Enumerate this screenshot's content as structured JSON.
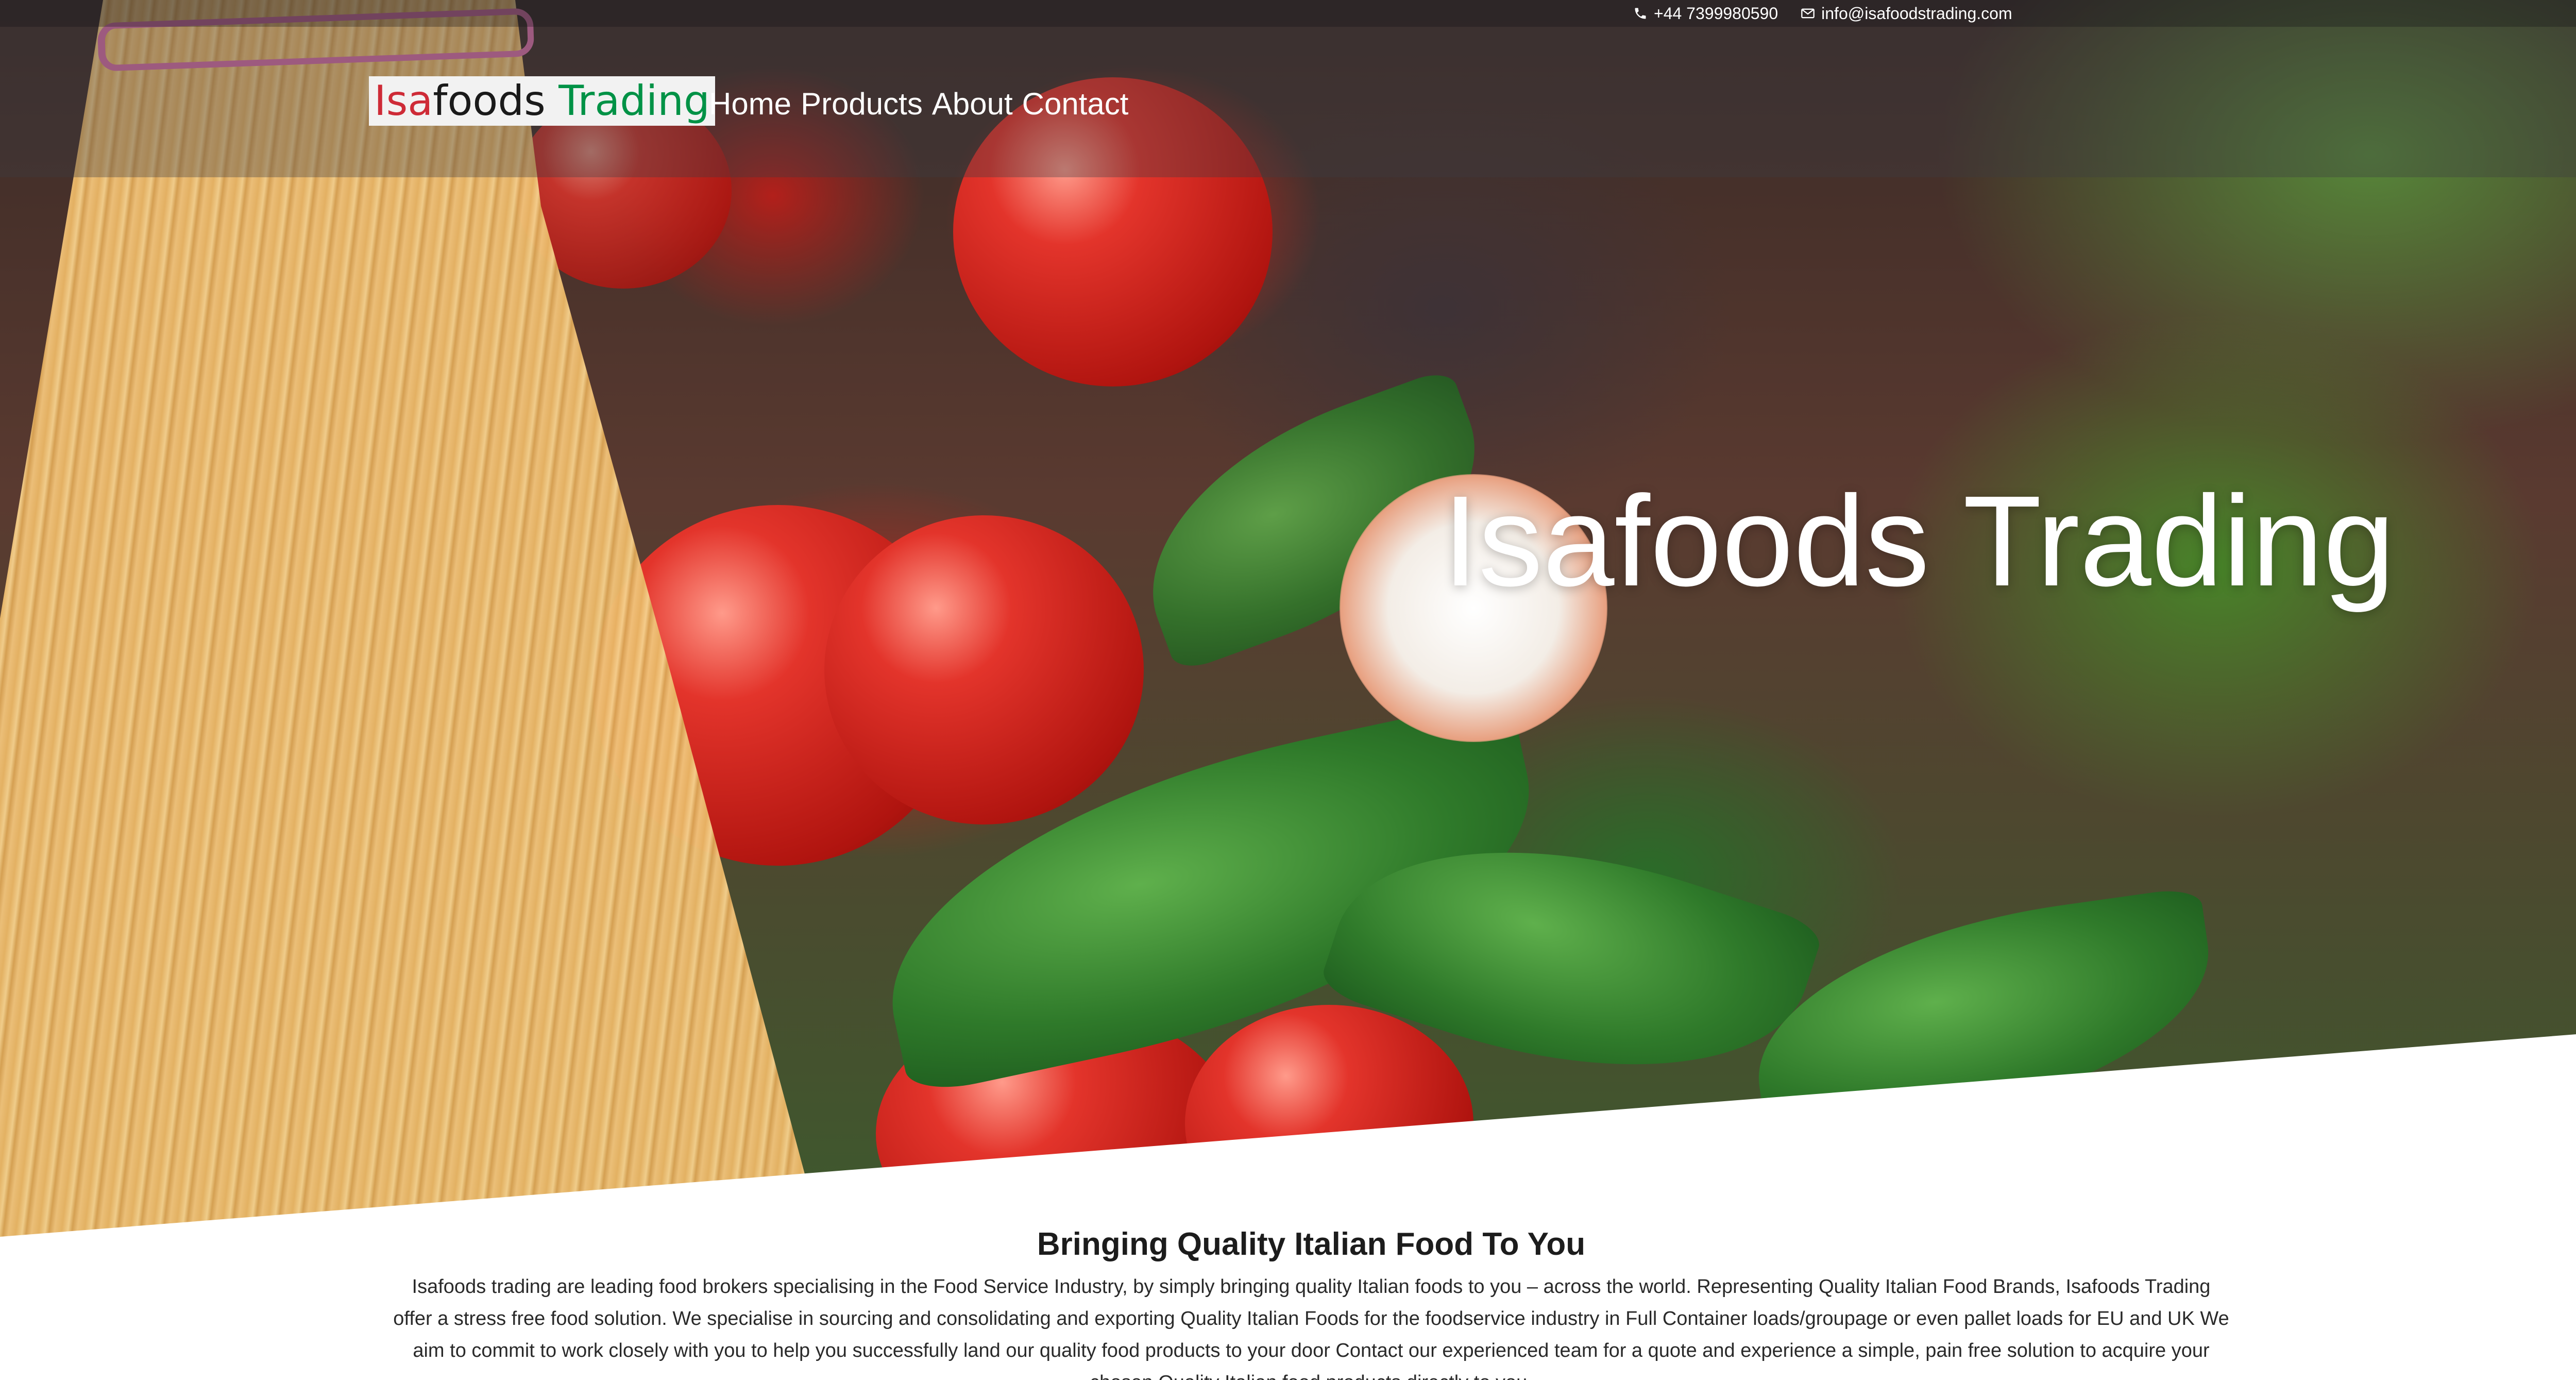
{
  "topbar": {
    "phone": "+44 7399980590",
    "email": "info@isafoodstrading.com"
  },
  "logo": {
    "part1": "Isa",
    "part2": "foods",
    "part3": " Trading",
    "colors": {
      "part1": "#ce2b37",
      "part2": "#1a1a1a",
      "part3": "#009246"
    }
  },
  "nav": {
    "items": [
      {
        "label": "Home"
      },
      {
        "label": "Products"
      },
      {
        "label": "About"
      },
      {
        "label": "Contact"
      }
    ]
  },
  "hero": {
    "title": "Isafoods Trading"
  },
  "intro": {
    "heading": "Bringing Quality Italian Food To You",
    "body": "Isafoods trading are leading food brokers specialising in the Food Service Industry, by simply bringing quality Italian foods to you – across the world. Representing Quality Italian Food Brands, Isafoods Trading offer a stress free food solution. We specialise in sourcing and consolidating and exporting Quality Italian Foods for the foodservice industry in Full Container loads/groupage or even pallet loads for EU and UK We aim to commit to work closely with you to help you successfully land our quality food products to your door Contact our experienced team for a quote and experience a simple, pain free solution to acquire your chosen Quality Italian food products directly to you."
  }
}
